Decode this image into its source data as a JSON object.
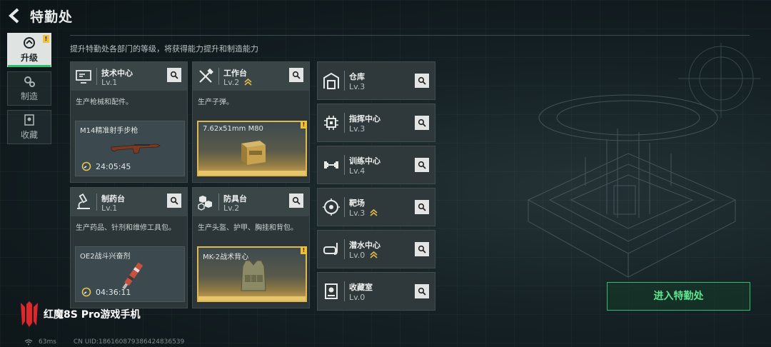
{
  "header": {
    "title": "特勤处",
    "subtitle": "提升特勤处各部门的等级，将获得能力提升和制造能力"
  },
  "nav": [
    {
      "label": "升级",
      "badge": "!",
      "active": true
    },
    {
      "label": "制造"
    },
    {
      "label": "收藏"
    }
  ],
  "cards": [
    {
      "name": "技术中心",
      "level": "Lv.1",
      "desc": "生产枪械和配件。",
      "product": "M14精准射手步枪",
      "timer": "24:05:45"
    },
    {
      "name": "工作台",
      "level": "Lv.2",
      "desc": "生产子弹。",
      "product": "7.62x51mm M80",
      "badge": "!"
    },
    {
      "name": "制药台",
      "level": "Lv.1",
      "desc": "生产药品、针剂和维修工具包。",
      "product": "OE2战斗兴奋剂",
      "timer": "04:36:11"
    },
    {
      "name": "防具台",
      "level": "Lv.2",
      "desc": "生产头盔、护甲、胸挂和背包。",
      "product": "MK-2战术背心",
      "badge": "!"
    }
  ],
  "facilities": [
    {
      "name": "仓库",
      "level": "Lv.3"
    },
    {
      "name": "指挥中心",
      "level": "Lv.3"
    },
    {
      "name": "训练中心",
      "level": "Lv.4"
    },
    {
      "name": "靶场",
      "level": "Lv.3"
    },
    {
      "name": "潜水中心",
      "level": "Lv.0"
    },
    {
      "name": "收藏室",
      "level": "Lv.0"
    }
  ],
  "enter_button": "进入特勤处",
  "watermark": {
    "brand": "红魔8S Pro游戏手机"
  },
  "footer": {
    "ping": "63ms",
    "uid": "CN UID:186160879386424836539"
  },
  "colors": {
    "accent_green": "#2fbf6a",
    "gold": "#e1b850",
    "badge_yellow": "#f0c233"
  }
}
